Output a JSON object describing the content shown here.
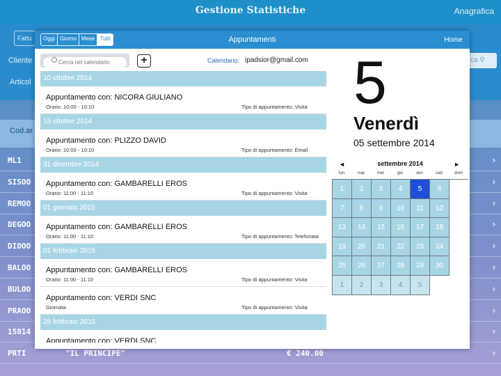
{
  "background_app": {
    "title": "Gestione Statistiche",
    "nav_right": "Anagrafica",
    "tab_partial": "Fattu",
    "field_cliente": "Cliente",
    "field_articolo": "Articol",
    "search_button_partial": "ca",
    "table_header": "Cod.ar",
    "rows": [
      {
        "code": "ML1",
        "desc": "",
        "price": ""
      },
      {
        "code": "SISOO",
        "desc": "",
        "price": ""
      },
      {
        "code": "REMOO",
        "desc": "",
        "price": ""
      },
      {
        "code": "DEGOO",
        "desc": "",
        "price": ""
      },
      {
        "code": "DIOOO",
        "desc": "",
        "price": ""
      },
      {
        "code": "BALOO",
        "desc": "",
        "price": ""
      },
      {
        "code": "BULOO",
        "desc": "",
        "price": ""
      },
      {
        "code": "PRAOO",
        "desc": "",
        "price": ""
      },
      {
        "code": "15014",
        "desc": "",
        "price": ""
      },
      {
        "code": "PRTI",
        "desc": "\"IL PRINCIPE\"",
        "price": "€ 240.00"
      }
    ]
  },
  "modal": {
    "segments": [
      {
        "label": "Oggi",
        "active": false
      },
      {
        "label": "Giorno",
        "active": false
      },
      {
        "label": "Mese",
        "active": false
      },
      {
        "label": "Tutti",
        "active": true
      }
    ],
    "title": "Appuntamenti",
    "home_label": "Home",
    "search_placeholder": "Cerca nel calendario",
    "add_label": "+",
    "calendar_label": "Calendario:",
    "calendar_email": "ipadsior@gmail.com"
  },
  "appointments": [
    {
      "date": "10 ottobre 2014",
      "items": [
        {
          "title": "Appuntamento con: NICORA GIULIANO",
          "time": "Orario: 10:00 - 10:10",
          "type": "Tipo di appuntamento: Visita"
        }
      ]
    },
    {
      "date": "15 ottobre 2014",
      "items": [
        {
          "title": "Appuntamento con: PLIZZO DAVID",
          "time": "Orario: 10:00 - 10:10",
          "type": "Tipo di appuntamento: Email"
        }
      ]
    },
    {
      "date": "31 dicembre 2014",
      "items": [
        {
          "title": "Appuntamento con: GAMBARELLI EROS",
          "time": "Orario: 11:00 - 11:10",
          "type": "Tipo di appuntamento: Visita"
        }
      ]
    },
    {
      "date": "01 gennaio 2015",
      "items": [
        {
          "title": "Appuntamento con: GAMBARELLI EROS",
          "time": "Orario: 11:00 - 11:10",
          "type": "Tipo di appuntamento: Telefonata"
        }
      ]
    },
    {
      "date": "01 febbraio 2015",
      "items": [
        {
          "title": "Appuntamento con: GAMBARELLI EROS",
          "time": "Orario: 11:00 - 11:10",
          "type": "Tipo di appuntamento: Visita"
        },
        {
          "title": "Appuntamento con: VERDI SNC",
          "time": "Giornata",
          "type": "Tipo di appuntamento: Visita"
        }
      ]
    },
    {
      "date": "28 febbraio 2015",
      "items": [
        {
          "title": "Appuntamento con: VERDI SNC",
          "time": "",
          "type": ""
        }
      ]
    }
  ],
  "calendar": {
    "big_day": "5",
    "weekday": "Venerdì",
    "full_date": "05 settembre 2014",
    "month_title": "settembre 2014",
    "prev_icon": "◄",
    "next_icon": "►",
    "weekdays": [
      "lun",
      "mar",
      "mer",
      "gio",
      "ven",
      "sab",
      "dom"
    ],
    "selected_day": "5",
    "days": [
      {
        "n": "1",
        "other": false
      },
      {
        "n": "2",
        "other": false
      },
      {
        "n": "3",
        "other": false
      },
      {
        "n": "4",
        "other": false
      },
      {
        "n": "5",
        "other": false
      },
      {
        "n": "6",
        "other": false
      },
      {
        "n": "7",
        "other": false
      },
      {
        "n": "8",
        "other": false
      },
      {
        "n": "9",
        "other": false
      },
      {
        "n": "10",
        "other": false
      },
      {
        "n": "11",
        "other": false
      },
      {
        "n": "12",
        "other": false
      },
      {
        "n": "13",
        "other": false
      },
      {
        "n": "14",
        "other": false
      },
      {
        "n": "15",
        "other": false
      },
      {
        "n": "16",
        "other": false
      },
      {
        "n": "17",
        "other": false
      },
      {
        "n": "18",
        "other": false
      },
      {
        "n": "19",
        "other": false
      },
      {
        "n": "20",
        "other": false
      },
      {
        "n": "21",
        "other": false
      },
      {
        "n": "22",
        "other": false
      },
      {
        "n": "23",
        "other": false
      },
      {
        "n": "24",
        "other": false
      },
      {
        "n": "25",
        "other": false
      },
      {
        "n": "26",
        "other": false
      },
      {
        "n": "27",
        "other": false
      },
      {
        "n": "28",
        "other": false
      },
      {
        "n": "29",
        "other": false
      },
      {
        "n": "30",
        "other": false
      },
      {
        "n": "1",
        "other": true
      },
      {
        "n": "2",
        "other": true
      },
      {
        "n": "3",
        "other": true
      },
      {
        "n": "4",
        "other": true
      },
      {
        "n": "5",
        "other": true
      }
    ]
  },
  "colors": {
    "nav_blue": "#2a8ed0",
    "section_header": "#a8d5e3",
    "selected_day": "#1f4fd6"
  }
}
